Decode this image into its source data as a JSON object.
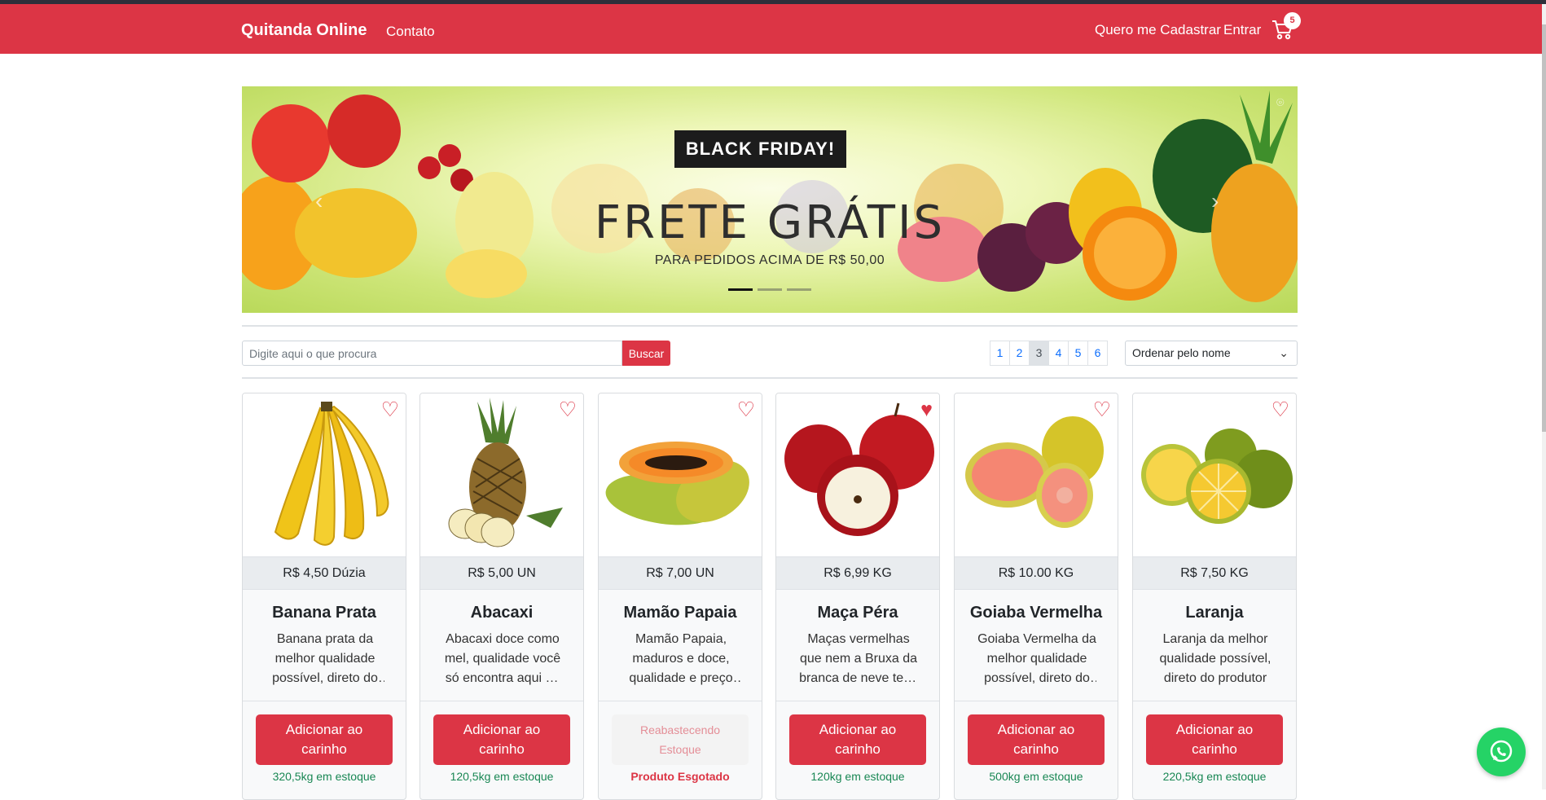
{
  "navbar": {
    "brand": "Quitanda Online",
    "links": {
      "contato": "Contato",
      "cadastrar": "Quero me Cadastrar",
      "entrar": "Entrar"
    },
    "cart_count": "5",
    "colors": {
      "brand": "#dc3545"
    }
  },
  "banner": {
    "badge": "BLACK FRIDAY!",
    "headline": "FRETE GRÁTIS",
    "subline": "PARA PEDIDOS ACIMA DE R$ 50,00",
    "slides": 3,
    "active_slide": 1
  },
  "toolbar": {
    "search_placeholder": "Digite aqui o que procura",
    "search_button": "Buscar",
    "pages": [
      "1",
      "2",
      "3",
      "4",
      "5",
      "6"
    ],
    "active_page": "3",
    "sort_selected": "Ordenar pelo nome"
  },
  "products": [
    {
      "price": "R$ 4,50 Dúzia",
      "name": "Banana Prata",
      "desc": "Banana prata da melhor qualidade possível, direto do produtor",
      "button": "Adicionar ao carinho",
      "stock": "320,5kg em estoque",
      "favorite": false,
      "available": true,
      "icon": "banana-image"
    },
    {
      "price": "R$ 5,00 UN",
      "name": "Abacaxi",
      "desc": "Abacaxi doce como mel, qualidade você só encontra aqui na quitanda",
      "button": "Adicionar ao carinho",
      "stock": "120,5kg em estoque",
      "favorite": false,
      "available": true,
      "icon": "pineapple-image"
    },
    {
      "price": "R$ 7,00 UN",
      "name": "Mamão Papaia",
      "desc": "Mamão Papaia, maduros e doce, qualidade e preço bom",
      "button": "Reabastecendo Estoque",
      "stock": "Produto Esgotado",
      "favorite": false,
      "available": false,
      "icon": "papaya-image"
    },
    {
      "price": "R$ 6,99 KG",
      "name": "Maça Péra",
      "desc": "Maças vermelhas que nem a Bruxa da branca de neve tem, você só encontra aqui",
      "button": "Adicionar ao carinho",
      "stock": "120kg em estoque",
      "favorite": true,
      "available": true,
      "icon": "apple-image"
    },
    {
      "price": "R$ 10.00 KG",
      "name": "Goiaba Vermelha",
      "desc": "Goiaba Vermelha da melhor qualidade possível, direto do produtor",
      "button": "Adicionar ao carinho",
      "stock": "500kg em estoque",
      "favorite": false,
      "available": true,
      "icon": "guava-image"
    },
    {
      "price": "R$ 7,50 KG",
      "name": "Laranja",
      "desc": "Laranja da melhor qualidade possível, direto do produtor",
      "button": "Adicionar ao carinho",
      "stock": "220,5kg em estoque",
      "favorite": false,
      "available": true,
      "icon": "orange-image"
    }
  ]
}
